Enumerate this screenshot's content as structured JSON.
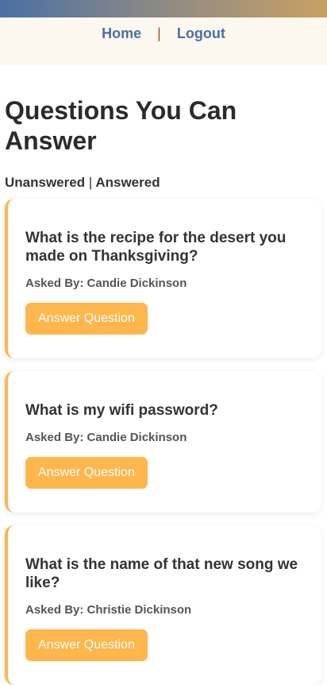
{
  "nav": {
    "home": "Home",
    "separator": "|",
    "logout": "Logout"
  },
  "page_title": "Questions You Can Answer",
  "tabs": {
    "unanswered": "Unanswered",
    "separator": "|",
    "answered": "Answered"
  },
  "questions": [
    {
      "text": "What is the recipe for the desert you made on Thanksgiving?",
      "asked_by": "Asked By: Candie Dickinson",
      "button": "Answer Question"
    },
    {
      "text": "What is my wifi password?",
      "asked_by": "Asked By: Candie Dickinson",
      "button": "Answer Question"
    },
    {
      "text": "What is the name of that new song we like?",
      "asked_by": "Asked By: Christie Dickinson",
      "button": "Answer Question"
    }
  ],
  "colors": {
    "accent": "#ffb64d",
    "link": "#4a6fa5"
  }
}
